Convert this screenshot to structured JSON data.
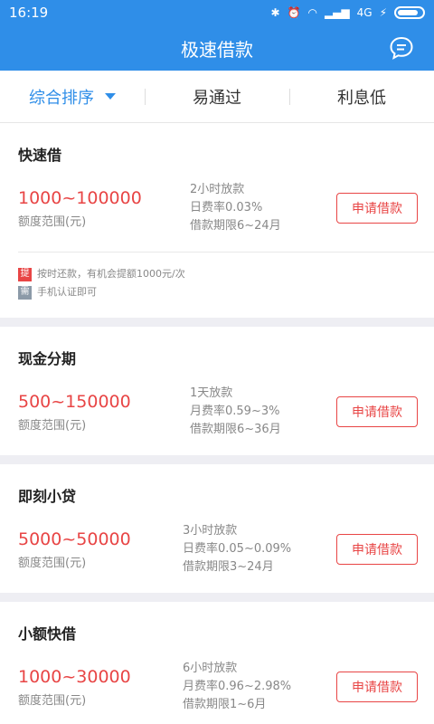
{
  "status": {
    "time": "16:19",
    "network": "4G"
  },
  "header": {
    "title": "极速借款"
  },
  "filters": [
    {
      "label": "综合排序",
      "active": true
    },
    {
      "label": "易通过",
      "active": false
    },
    {
      "label": "利息低",
      "active": false
    }
  ],
  "cards": [
    {
      "name": "快速借",
      "amount": "1000~100000",
      "amount_label": "额度范围(元)",
      "info": [
        "2小时放款",
        "日费率0.03%",
        "借款期限6~24月"
      ],
      "button": "申请借款",
      "tags": [
        {
          "badge": "提",
          "color": "#e84545",
          "text": "按时还款，有机会提额1000元/次"
        },
        {
          "badge": "需",
          "color": "#8c9aa8",
          "text": "手机认证即可"
        }
      ]
    },
    {
      "name": "现金分期",
      "amount": "500~150000",
      "amount_label": "额度范围(元)",
      "info": [
        "1天放款",
        "月费率0.59~3%",
        "借款期限6~36月"
      ],
      "button": "申请借款"
    },
    {
      "name": "即刻小贷",
      "amount": "5000~50000",
      "amount_label": "额度范围(元)",
      "info": [
        "3小时放款",
        "日费率0.05~0.09%",
        "借款期限3~24月"
      ],
      "button": "申请借款"
    },
    {
      "name": "小额快借",
      "amount": "1000~30000",
      "amount_label": "额度范围(元)",
      "info": [
        "6小时放款",
        "月费率0.96~2.98%",
        "借款期限1~6月"
      ],
      "button": "申请借款"
    }
  ]
}
